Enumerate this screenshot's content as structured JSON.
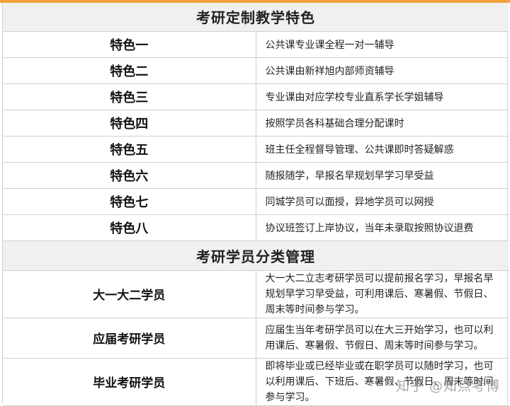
{
  "section1": {
    "title": "考研定制教学特色",
    "rows": [
      {
        "label": "特色一",
        "text": "公共课专业课全程一对一辅导"
      },
      {
        "label": "特色二",
        "text": "公共课由新祥旭内部师资辅导"
      },
      {
        "label": "特色三",
        "text": "专业课由对应学校专业直系学长学姐辅导"
      },
      {
        "label": "特色四",
        "text": "按照学员各科基础合理分配课时"
      },
      {
        "label": "特色五",
        "text": "班主任全程督导管理、公共课即时答疑解惑"
      },
      {
        "label": "特色六",
        "text": "随报随学，早报名早规划早学习早受益"
      },
      {
        "label": "特色七",
        "text": "同城学员可以面授，异地学员可以网授"
      },
      {
        "label": "特色八",
        "text": "协议班签订上岸协议，当年未录取按照协议退费"
      }
    ]
  },
  "section2": {
    "title": "考研学员分类管理",
    "rows": [
      {
        "label": "大一大二学员",
        "text": "大一大二立志考研学员可以提前报名学习，早报名早规划早学习早受益，可利用课后、寒暑假、节假日、周末等时间参与学习。"
      },
      {
        "label": "应届考研学员",
        "text": "应届生当年考研学员可以在大三开始学习，也可以利用课后、寒暑假、节假日、周末等时间参与学习。"
      },
      {
        "label": "毕业考研学员",
        "text": "即将毕业或已经毕业或在职学员可以随时学习，也可以利用课后、下班后、寒暑假、节假日、周末等时间参与学习。"
      }
    ]
  },
  "watermark": "知乎 @知点考博"
}
